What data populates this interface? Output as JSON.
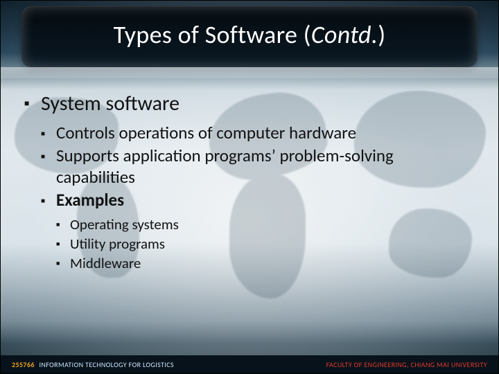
{
  "title": {
    "main": "Types of Software (",
    "contd": "Contd.",
    "close": ")"
  },
  "content": {
    "l1": {
      "0": "System software"
    },
    "l2": {
      "0": "Controls operations of computer hardware",
      "1": "Supports application programs’ problem-solving capabilities",
      "2": "Examples"
    },
    "l3": {
      "0": "Operating systems",
      "1": "Utility programs",
      "2": "Middleware"
    }
  },
  "footer": {
    "course_code": "255766",
    "course_name": "INFORMATION TECHNOLOGY FOR LOGISTICS",
    "faculty": "FACULTY OF ENGINEERING, CHIANG MAI UNIVERSITY"
  }
}
